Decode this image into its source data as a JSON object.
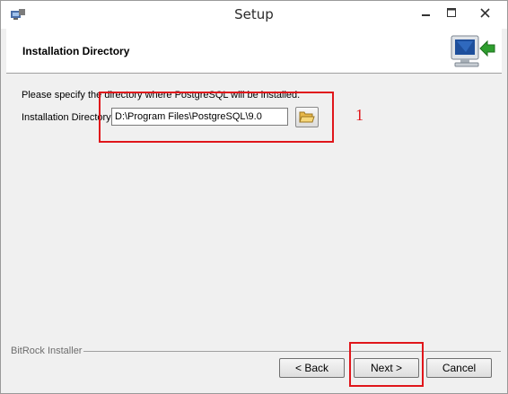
{
  "window": {
    "title": "Setup"
  },
  "header": {
    "title": "Installation Directory"
  },
  "content": {
    "instructions": "Please specify the directory where PostgreSQL will be installed.",
    "dir_label": "Installation Directory",
    "dir_value": "D:\\Program Files\\PostgreSQL\\9.0"
  },
  "annotation": {
    "marker": "1",
    "color": "#e0161b"
  },
  "footer": {
    "brand": "BitRock Installer",
    "back_label": "< Back",
    "next_label": "Next >",
    "cancel_label": "Cancel"
  },
  "icons": [
    "app-icon",
    "minimize-icon",
    "maximize-icon",
    "close-icon",
    "installer-computer-icon",
    "folder-open-icon"
  ]
}
